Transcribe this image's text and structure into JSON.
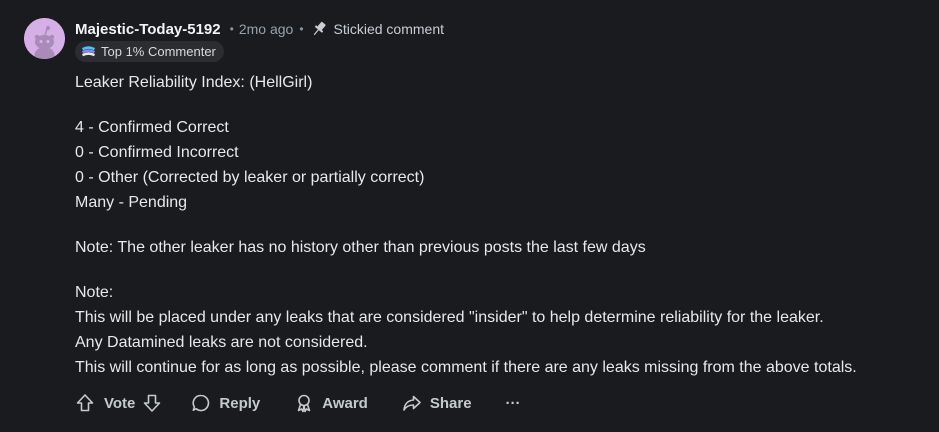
{
  "comment": {
    "author": "Majestic-Today-5192",
    "time": "2mo ago",
    "separator": "•",
    "stickied_label": "Stickied comment",
    "flair": "Top 1% Commenter",
    "avatar_color": "#d5b0e6",
    "icons": {
      "avatar": "snoo-avatar-icon",
      "pin": "pin-icon",
      "flair": "commenter-badge-icon"
    },
    "body": {
      "heading": "Leaker Reliability Index: (HellGirl)",
      "stats": [
        "4 - Confirmed Correct",
        "0 - Confirmed Incorrect",
        "0 - Other (Corrected by leaker or partially correct)",
        "Many - Pending"
      ],
      "note1": "Note: The other leaker has no history other than previous posts the last few days",
      "note2": [
        "Note:",
        "This will be placed under any leaks that are considered \"insider\" to help determine reliability for the leaker.",
        "Any Datamined leaks are not considered.",
        "This will continue for as long as possible, please comment if there are any leaks missing from the above totals."
      ]
    }
  },
  "actions": {
    "vote": "Vote",
    "reply": "Reply",
    "award": "Award",
    "share": "Share",
    "more": "···",
    "icons": {
      "upvote": "upvote-arrow-icon",
      "downvote": "downvote-arrow-icon",
      "reply": "speech-bubble-icon",
      "award": "award-ribbon-icon",
      "share": "share-arrow-icon",
      "more": "ellipsis-icon"
    }
  }
}
